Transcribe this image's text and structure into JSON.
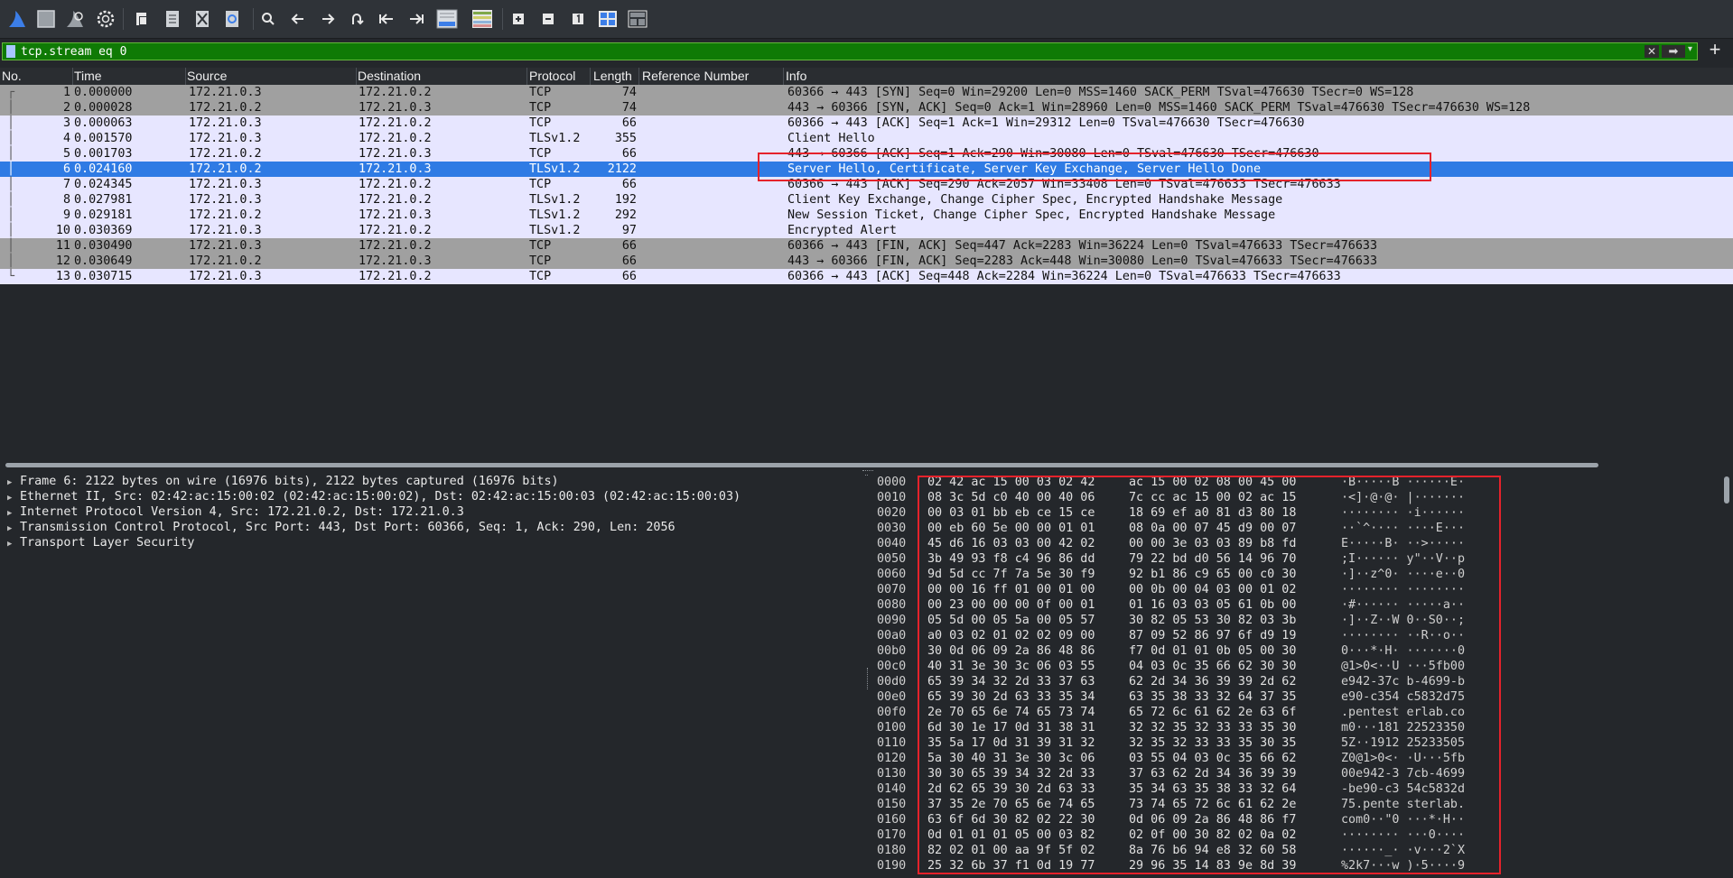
{
  "toolbar": {
    "icons": [
      "shark-fin-start-icon",
      "stop-capture-icon",
      "restart-capture-icon",
      "capture-options-icon",
      "open-file-icon",
      "save-file-icon",
      "close-file-icon",
      "reload-file-icon",
      "find-packet-icon",
      "go-back-icon",
      "go-forward-icon",
      "go-to-packet-icon",
      "go-first-icon",
      "go-last-icon",
      "auto-scroll-icon",
      "colorize-icon",
      "zoom-in-icon",
      "zoom-out-icon",
      "normal-size-icon",
      "resize-columns-icon",
      "layout-icon"
    ]
  },
  "filter": {
    "value": "tcp.stream eq 0",
    "add_label": "+"
  },
  "columns": [
    "No.",
    "Time",
    "Source",
    "Destination",
    "Protocol",
    "Length",
    "Reference Number",
    "Info"
  ],
  "packets": [
    {
      "no": "1",
      "time": "0.000000",
      "src": "172.21.0.3",
      "dst": "172.21.0.2",
      "proto": "TCP",
      "len": "74",
      "info": "60366 → 443 [SYN] Seq=0 Win=29200 Len=0 MSS=1460 SACK_PERM TSval=476630 TSecr=0 WS=128",
      "bg": "#a0a0a0"
    },
    {
      "no": "2",
      "time": "0.000028",
      "src": "172.21.0.2",
      "dst": "172.21.0.3",
      "proto": "TCP",
      "len": "74",
      "info": "443 → 60366 [SYN, ACK] Seq=0 Ack=1 Win=28960 Len=0 MSS=1460 SACK_PERM TSval=476630 TSecr=476630 WS=128",
      "bg": "#a0a0a0"
    },
    {
      "no": "3",
      "time": "0.000063",
      "src": "172.21.0.3",
      "dst": "172.21.0.2",
      "proto": "TCP",
      "len": "66",
      "info": "60366 → 443 [ACK] Seq=1 Ack=1 Win=29312 Len=0 TSval=476630 TSecr=476630",
      "bg": "#e7e6ff"
    },
    {
      "no": "4",
      "time": "0.001570",
      "src": "172.21.0.3",
      "dst": "172.21.0.2",
      "proto": "TLSv1.2",
      "len": "355",
      "info": "Client Hello",
      "bg": "#e7e6ff"
    },
    {
      "no": "5",
      "time": "0.001703",
      "src": "172.21.0.2",
      "dst": "172.21.0.3",
      "proto": "TCP",
      "len": "66",
      "info": "443 → 60366 [ACK] Seq=1 Ack=290 Win=30080 Len=0 TSval=476630 TSecr=476630",
      "bg": "#e7e6ff"
    },
    {
      "no": "6",
      "time": "0.024160",
      "src": "172.21.0.2",
      "dst": "172.21.0.3",
      "proto": "TLSv1.2",
      "len": "2122",
      "info": "Server Hello, Certificate, Server Key Exchange, Server Hello Done",
      "bg": "#2f7be4",
      "selected": true
    },
    {
      "no": "7",
      "time": "0.024345",
      "src": "172.21.0.3",
      "dst": "172.21.0.2",
      "proto": "TCP",
      "len": "66",
      "info": "60366 → 443 [ACK] Seq=290 Ack=2057 Win=33408 Len=0 TSval=476633 TSecr=476633",
      "bg": "#e7e6ff"
    },
    {
      "no": "8",
      "time": "0.027981",
      "src": "172.21.0.3",
      "dst": "172.21.0.2",
      "proto": "TLSv1.2",
      "len": "192",
      "info": "Client Key Exchange, Change Cipher Spec, Encrypted Handshake Message",
      "bg": "#e7e6ff"
    },
    {
      "no": "9",
      "time": "0.029181",
      "src": "172.21.0.2",
      "dst": "172.21.0.3",
      "proto": "TLSv1.2",
      "len": "292",
      "info": "New Session Ticket, Change Cipher Spec, Encrypted Handshake Message",
      "bg": "#e7e6ff"
    },
    {
      "no": "10",
      "time": "0.030369",
      "src": "172.21.0.3",
      "dst": "172.21.0.2",
      "proto": "TLSv1.2",
      "len": "97",
      "info": "Encrypted Alert",
      "bg": "#e7e6ff"
    },
    {
      "no": "11",
      "time": "0.030490",
      "src": "172.21.0.3",
      "dst": "172.21.0.2",
      "proto": "TCP",
      "len": "66",
      "info": "60366 → 443 [FIN, ACK] Seq=447 Ack=2283 Win=36224 Len=0 TSval=476633 TSecr=476633",
      "bg": "#a0a0a0"
    },
    {
      "no": "12",
      "time": "0.030649",
      "src": "172.21.0.2",
      "dst": "172.21.0.3",
      "proto": "TCP",
      "len": "66",
      "info": "443 → 60366 [FIN, ACK] Seq=2283 Ack=448 Win=30080 Len=0 TSval=476633 TSecr=476633",
      "bg": "#a0a0a0"
    },
    {
      "no": "13",
      "time": "0.030715",
      "src": "172.21.0.3",
      "dst": "172.21.0.2",
      "proto": "TCP",
      "len": "66",
      "info": "60366 → 443 [ACK] Seq=448 Ack=2284 Win=36224 Len=0 TSval=476633 TSecr=476633",
      "bg": "#e7e6ff"
    }
  ],
  "details": [
    "Frame 6: 2122 bytes on wire (16976 bits), 2122 bytes captured (16976 bits)",
    "Ethernet II, Src: 02:42:ac:15:00:02 (02:42:ac:15:00:02), Dst: 02:42:ac:15:00:03 (02:42:ac:15:00:03)",
    "Internet Protocol Version 4, Src: 172.21.0.2, Dst: 172.21.0.3",
    "Transmission Control Protocol, Src Port: 443, Dst Port: 60366, Seq: 1, Ack: 290, Len: 2056",
    "Transport Layer Security"
  ],
  "bytes": [
    {
      "off": "0000",
      "h1": "02 42 ac 15 00 03 02 42",
      "h2": "ac 15 00 02 08 00 45 00",
      "asc": "·B·····B ······E·"
    },
    {
      "off": "0010",
      "h1": "08 3c 5d c0 40 00 40 06",
      "h2": "7c cc ac 15 00 02 ac 15",
      "asc": "·<]·@·@· |·······"
    },
    {
      "off": "0020",
      "h1": "00 03 01 bb eb ce 15 ce",
      "h2": "18 69 ef a0 81 d3 80 18",
      "asc": "········ ·i······"
    },
    {
      "off": "0030",
      "h1": "00 eb 60 5e 00 00 01 01",
      "h2": "08 0a 00 07 45 d9 00 07",
      "asc": "··`^···· ····E···"
    },
    {
      "off": "0040",
      "h1": "45 d6 16 03 03 00 42 02",
      "h2": "00 00 3e 03 03 89 b8 fd",
      "asc": "E·····B· ··>·····"
    },
    {
      "off": "0050",
      "h1": "3b 49 93 f8 c4 96 86 dd",
      "h2": "79 22 bd d0 56 14 96 70",
      "asc": ";I······ y\"··V··p"
    },
    {
      "off": "0060",
      "h1": "9d 5d cc 7f 7a 5e 30 f9",
      "h2": "92 b1 86 c9 65 00 c0 30",
      "asc": "·]··z^0· ····e··0"
    },
    {
      "off": "0070",
      "h1": "00 00 16 ff 01 00 01 00",
      "h2": "00 0b 00 04 03 00 01 02",
      "asc": "········ ········"
    },
    {
      "off": "0080",
      "h1": "00 23 00 00 00 0f 00 01",
      "h2": "01 16 03 03 05 61 0b 00",
      "asc": "·#······ ·····a··"
    },
    {
      "off": "0090",
      "h1": "05 5d 00 05 5a 00 05 57",
      "h2": "30 82 05 53 30 82 03 3b",
      "asc": "·]··Z··W 0··S0··;"
    },
    {
      "off": "00a0",
      "h1": "a0 03 02 01 02 02 09 00",
      "h2": "87 09 52 86 97 6f d9 19",
      "asc": "········ ··R··o··"
    },
    {
      "off": "00b0",
      "h1": "30 0d 06 09 2a 86 48 86",
      "h2": "f7 0d 01 01 0b 05 00 30",
      "asc": "0···*·H· ·······0"
    },
    {
      "off": "00c0",
      "h1": "40 31 3e 30 3c 06 03 55",
      "h2": "04 03 0c 35 66 62 30 30",
      "asc": "@1>0<··U ···5fb00"
    },
    {
      "off": "00d0",
      "h1": "65 39 34 32 2d 33 37 63",
      "h2": "62 2d 34 36 39 39 2d 62",
      "asc": "e942-37c b-4699-b"
    },
    {
      "off": "00e0",
      "h1": "65 39 30 2d 63 33 35 34",
      "h2": "63 35 38 33 32 64 37 35",
      "asc": "e90-c354 c5832d75"
    },
    {
      "off": "00f0",
      "h1": "2e 70 65 6e 74 65 73 74",
      "h2": "65 72 6c 61 62 2e 63 6f",
      "asc": ".pentest erlab.co"
    },
    {
      "off": "0100",
      "h1": "6d 30 1e 17 0d 31 38 31",
      "h2": "32 32 35 32 33 33 35 30",
      "asc": "m0···181 22523350"
    },
    {
      "off": "0110",
      "h1": "35 5a 17 0d 31 39 31 32",
      "h2": "32 35 32 33 33 35 30 35",
      "asc": "5Z··1912 25233505"
    },
    {
      "off": "0120",
      "h1": "5a 30 40 31 3e 30 3c 06",
      "h2": "03 55 04 03 0c 35 66 62",
      "asc": "Z0@1>0<· ·U···5fb"
    },
    {
      "off": "0130",
      "h1": "30 30 65 39 34 32 2d 33",
      "h2": "37 63 62 2d 34 36 39 39",
      "asc": "00e942-3 7cb-4699"
    },
    {
      "off": "0140",
      "h1": "2d 62 65 39 30 2d 63 33",
      "h2": "35 34 63 35 38 33 32 64",
      "asc": "-be90-c3 54c5832d"
    },
    {
      "off": "0150",
      "h1": "37 35 2e 70 65 6e 74 65",
      "h2": "73 74 65 72 6c 61 62 2e",
      "asc": "75.pente sterlab."
    },
    {
      "off": "0160",
      "h1": "63 6f 6d 30 82 02 22 30",
      "h2": "0d 06 09 2a 86 48 86 f7",
      "asc": "com0··\"0 ···*·H··"
    },
    {
      "off": "0170",
      "h1": "0d 01 01 01 05 00 03 82",
      "h2": "02 0f 00 30 82 02 0a 02",
      "asc": "········ ···0····"
    },
    {
      "off": "0180",
      "h1": "82 02 01 00 aa 9f 5f 02",
      "h2": "8a 76 b6 94 e8 32 60 58",
      "asc": "······_· ·v···2`X"
    },
    {
      "off": "0190",
      "h1": "25 32 6b 37 f1 0d 19 77",
      "h2": "29 96 35 14 83 9e 8d 39",
      "asc": "%2k7···w )·5····9"
    }
  ]
}
